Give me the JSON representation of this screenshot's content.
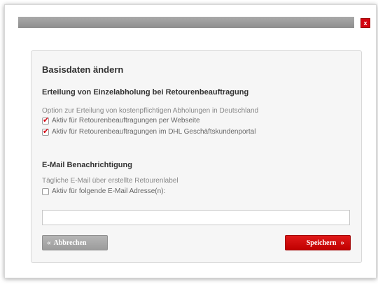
{
  "header": {
    "close_label": "x"
  },
  "form": {
    "title": "Basisdaten ändern",
    "pickup_section": {
      "heading": "Erteilung von Einzelabholung bei Retourenbeauftragung",
      "description": "Option zur Erteilung von kostenpflichtigen Abholungen in Deutschland",
      "options": [
        {
          "label": "Aktiv für Retourenbeauftragungen per Webseite",
          "checked": true
        },
        {
          "label": "Aktiv für Retourenbeauftragungen im DHL Geschäftskundenportal",
          "checked": true
        }
      ]
    },
    "email_section": {
      "heading": "E-Mail Benachrichtigung",
      "description": "Tägliche E-Mail über erstellte Retourenlabel",
      "option": {
        "label": "Aktiv für folgende E-Mail Adresse(n):",
        "checked": false
      },
      "input_value": ""
    },
    "cancel_label": "Abbrechen",
    "save_label": "Speichern",
    "cancel_chevron": "«",
    "save_chevron": "»"
  },
  "colors": {
    "accent": "#d40511",
    "grey_button": "#a8a8a8",
    "panel_bg": "#f6f6f6"
  }
}
